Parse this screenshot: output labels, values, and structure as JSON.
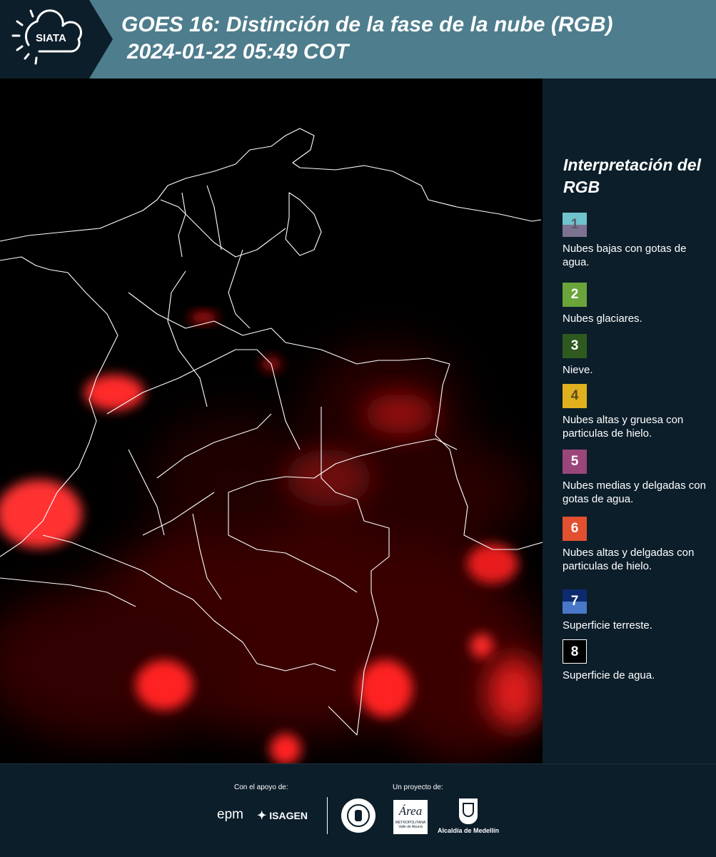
{
  "header": {
    "logo_text": "SIATA",
    "title_line1": "GOES 16: Distinción de la fase de la nube (RGB)",
    "title_line2": "2024-01-22 05:49 COT"
  },
  "legend": {
    "title": "Interpretación del RGB",
    "items": [
      {
        "number": "1",
        "label": "Nubes bajas con gotas de agua.",
        "color_top": "#6fc3cc",
        "color_bottom": "#7d7391",
        "text_color": "#5a5a6a"
      },
      {
        "number": "2",
        "label": "Nubes glaciares.",
        "color_top": "#6aa43a",
        "color_bottom": "#6aa43a",
        "text_color": "#ffffff"
      },
      {
        "number": "3",
        "label": "Nieve.",
        "color_top": "#2e5a1f",
        "color_bottom": "#2e5a1f",
        "text_color": "#ffffff"
      },
      {
        "number": "4",
        "label": "Nubes altas y gruesa con particulas de hielo.",
        "color_top": "#e0b01e",
        "color_bottom": "#e0b01e",
        "text_color": "#5a4a20"
      },
      {
        "number": "5",
        "label": "Nubes medias y delgadas con gotas de agua.",
        "color_top": "#9b467a",
        "color_bottom": "#9b467a",
        "text_color": "#ffffff"
      },
      {
        "number": "6",
        "label": "Nubes altas y delgadas con particulas de hielo.",
        "color_top": "#e2502f",
        "color_bottom": "#e2502f",
        "text_color": "#ffffff"
      },
      {
        "number": "7",
        "label": "Superficie terreste.",
        "color_top": "#0c2a6e",
        "color_bottom": "#4a78c8",
        "text_color": "#ffffff"
      },
      {
        "number": "8",
        "label": "Superficie de agua.",
        "color_top": "#000000",
        "color_bottom": "#000000",
        "text_color": "#ffffff"
      }
    ]
  },
  "footer": {
    "support_label": "Con el apoyo de:",
    "project_label": "Un proyecto de:",
    "epm": "epm",
    "isagen": "ISAGEN",
    "area_name": "Área",
    "area_sub1": "METROPOLITANA",
    "area_sub2": "Valle de Aburrá",
    "alcaldia": "Alcaldía de Medellín"
  },
  "map": {
    "background_color": "#000000",
    "cloud_color": "#ff2020",
    "border_color": "#ffffff"
  }
}
